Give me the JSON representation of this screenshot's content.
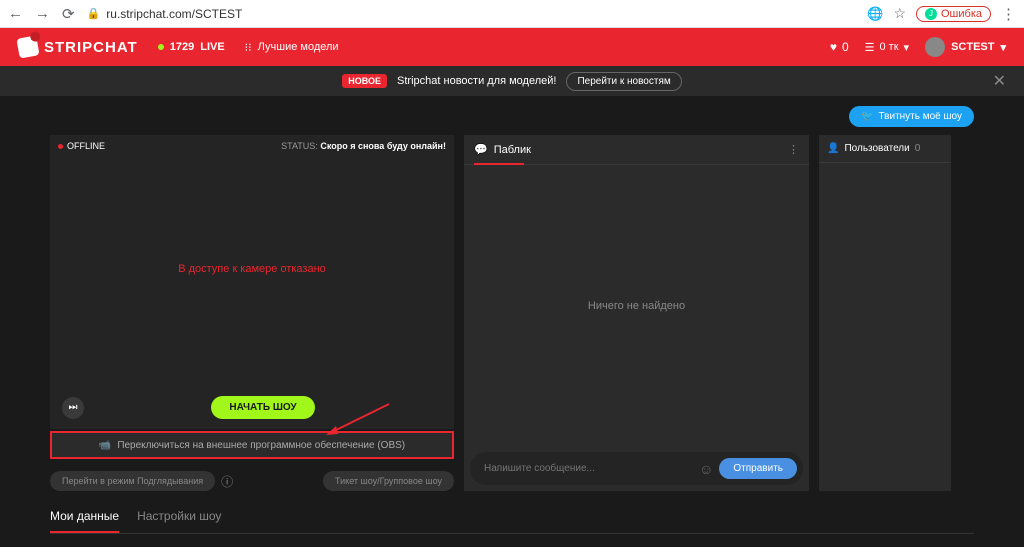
{
  "browser": {
    "url": "ru.stripchat.com/SCTEST",
    "error_label": "Ошибка"
  },
  "header": {
    "brand": "STRIPCHAT",
    "live_count": "1729",
    "live_label": "LIVE",
    "top_models": "Лучшие модели",
    "hearts": "0",
    "tokens": "0 тк",
    "username": "SCTEST"
  },
  "news": {
    "badge": "НОВОЕ",
    "text": "Stripchat новости для моделей!",
    "button": "Перейти к новостям"
  },
  "tweet_button": "Твитнуть моё шоу",
  "video": {
    "offline_label": "OFFLINE",
    "status_prefix": "STATUS:",
    "status_value": "Скоро я снова буду онлайн!",
    "camera_denied": "В доступе к камере отказано",
    "start_button": "НАЧАТЬ ШОУ",
    "obs_switch": "Переключиться на внешнее программное обеспечение (OBS)",
    "spy_button": "Перейти в режим Подглядывания",
    "ticket_button": "Тикет шоу/Групповое шоу"
  },
  "chat": {
    "tab_label": "Паблик",
    "empty": "Ничего не найдено",
    "placeholder": "Напишите сообщение...",
    "send": "Отправить"
  },
  "users": {
    "label": "Пользователи",
    "count": "0"
  },
  "tabs": {
    "my_data": "Мои данные",
    "show_settings": "Настройки шоу"
  }
}
